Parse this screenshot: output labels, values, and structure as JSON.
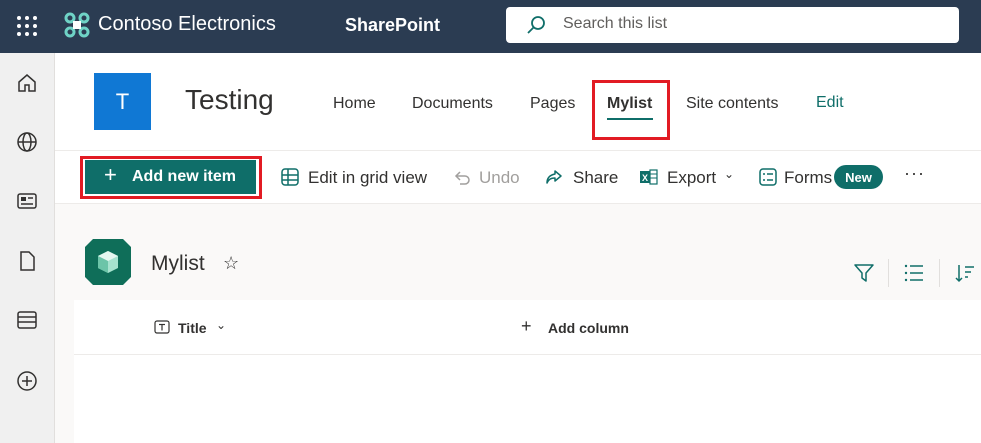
{
  "suite": {
    "org_name": "Contoso Electronics",
    "app_name": "SharePoint",
    "search_placeholder": "Search this list",
    "icons": {
      "waffle": "app-launcher-icon",
      "logo": "contoso-logo-icon",
      "search": "search-icon"
    }
  },
  "app_bar": {
    "icons": [
      "home-icon",
      "globe-icon",
      "news-icon",
      "file-icon",
      "list-icon",
      "add-icon"
    ]
  },
  "site": {
    "logo_letter": "T",
    "title": "Testing",
    "nav": [
      {
        "label": "Home"
      },
      {
        "label": "Documents"
      },
      {
        "label": "Pages"
      },
      {
        "label": "Mylist",
        "selected": true
      },
      {
        "label": "Site contents"
      }
    ],
    "edit_label": "Edit"
  },
  "commands": {
    "add_new_item": "Add new item",
    "edit_grid": "Edit in grid view",
    "undo": "Undo",
    "share": "Share",
    "export": "Export",
    "forms": "Forms",
    "forms_badge": "New",
    "more": "···"
  },
  "list": {
    "name": "Mylist",
    "star": "☆",
    "columns": [
      {
        "label": "Title"
      },
      {
        "label": "Add column"
      }
    ]
  },
  "colors": {
    "suite_bar": "#2b3c52",
    "accent": "#0f6e69",
    "site_logo": "#1078d4",
    "highlight": "#e21b23"
  }
}
